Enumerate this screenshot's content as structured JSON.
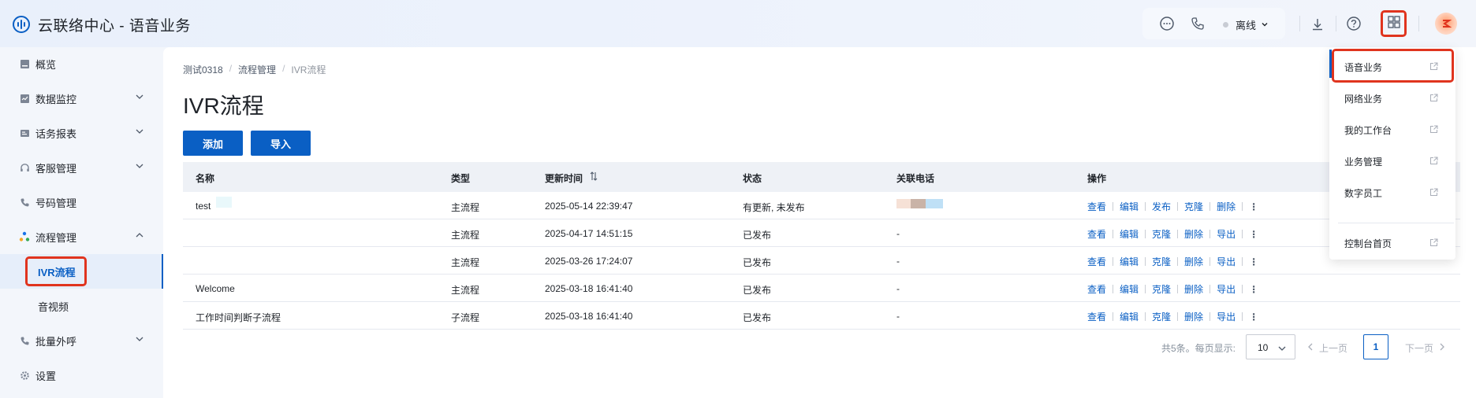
{
  "header": {
    "app_title": "云联络中心 - 语音业务",
    "status_label": "离线",
    "colors": {
      "accent": "#0a5fc4",
      "highlight_box": "#e0341e"
    }
  },
  "sidebar": {
    "items": [
      {
        "label": "概览",
        "icon": "overview-icon"
      },
      {
        "label": "数据监控",
        "icon": "monitor-icon",
        "expandable": true
      },
      {
        "label": "话务报表",
        "icon": "report-icon",
        "expandable": true
      },
      {
        "label": "客服管理",
        "icon": "headset-icon",
        "expandable": true
      },
      {
        "label": "号码管理",
        "icon": "phone-icon"
      },
      {
        "label": "流程管理",
        "icon": "flow-icon",
        "expanded": true
      },
      {
        "label": "IVR流程",
        "sub": true,
        "active": true
      },
      {
        "label": "音视频",
        "sub": true
      },
      {
        "label": "批量外呼",
        "icon": "outbound-icon",
        "expandable": true
      },
      {
        "label": "设置",
        "icon": "gear-icon"
      }
    ]
  },
  "breadcrumb": [
    "测试0318",
    "流程管理",
    "IVR流程"
  ],
  "page": {
    "title": "IVR流程",
    "add_label": "添加",
    "import_label": "导入"
  },
  "table": {
    "columns": [
      "名称",
      "类型",
      "更新时间",
      "状态",
      "关联电话",
      "操作"
    ],
    "rows": [
      {
        "name": "test",
        "type": "主流程",
        "updated": "2025-05-14 22:39:47",
        "status": "有更新, 未发布",
        "phone": "",
        "ops": [
          "查看",
          "编辑",
          "发布",
          "克隆",
          "删除"
        ]
      },
      {
        "name": "",
        "type": "主流程",
        "updated": "2025-04-17 14:51:15",
        "status": "已发布",
        "phone": "-",
        "ops": [
          "查看",
          "编辑",
          "克隆",
          "删除",
          "导出"
        ]
      },
      {
        "name": "",
        "type": "主流程",
        "updated": "2025-03-26 17:24:07",
        "status": "已发布",
        "phone": "-",
        "ops": [
          "查看",
          "编辑",
          "克隆",
          "删除",
          "导出"
        ]
      },
      {
        "name": "Welcome",
        "type": "主流程",
        "updated": "2025-03-18 16:41:40",
        "status": "已发布",
        "phone": "-",
        "ops": [
          "查看",
          "编辑",
          "克隆",
          "删除",
          "导出"
        ]
      },
      {
        "name": "工作时间判断子流程",
        "type": "子流程",
        "updated": "2025-03-18 16:41:40",
        "status": "已发布",
        "phone": "-",
        "ops": [
          "查看",
          "编辑",
          "克隆",
          "删除",
          "导出"
        ]
      }
    ]
  },
  "pagination": {
    "total_label": "共5条。每页显示:",
    "page_size": "10",
    "prev_label": "上一页",
    "next_label": "下一页",
    "current_page": "1"
  },
  "app_menu": {
    "items": [
      "语音业务",
      "网络业务",
      "我的工作台",
      "业务管理",
      "数字员工"
    ],
    "footer_item": "控制台首页"
  }
}
